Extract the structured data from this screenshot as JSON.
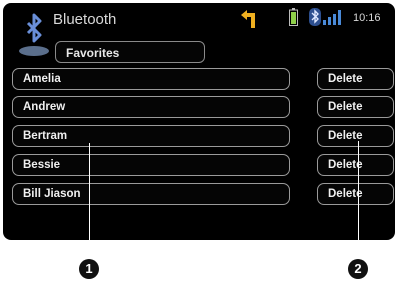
{
  "header": {
    "title": "Bluetooth",
    "tab_label": "Favorites",
    "clock": "10:16",
    "status_icons": [
      "navigation-arrow-icon",
      "battery-icon",
      "bluetooth-icon",
      "signal-bars-icon"
    ]
  },
  "contacts": [
    {
      "name": "Amelia",
      "action": "Delete"
    },
    {
      "name": "Andrew",
      "action": "Delete"
    },
    {
      "name": "Bertram",
      "action": "Delete"
    },
    {
      "name": "Bessie",
      "action": "Delete"
    },
    {
      "name": "Bill Jiason",
      "action": "Delete"
    }
  ],
  "callouts": [
    {
      "number": "1"
    },
    {
      "number": "2"
    }
  ],
  "colors": {
    "screen_bg": "#000000",
    "text": "#f0f0f0",
    "border": "#9a9a9a",
    "accent_nav": "#f0b020",
    "accent_battery": "#8fd04a",
    "accent_bluetooth": "#4a8ad8"
  }
}
